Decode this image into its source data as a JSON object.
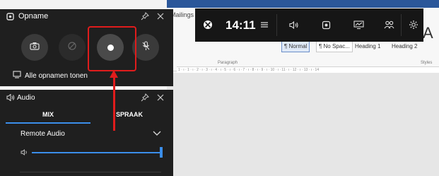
{
  "capture_panel": {
    "title": "Opname",
    "show_all_label": "Alle opnamen tonen"
  },
  "audio_panel": {
    "title": "Audio",
    "tabs": [
      "MIX",
      "SPRAAK"
    ],
    "active_tab": "MIX",
    "device": "Remote Audio",
    "volume_fraction": 1.0
  },
  "game_bar": {
    "time": "14:11"
  },
  "word_background": {
    "tab_label": "Mailings",
    "big_letter": "A",
    "styles": [
      "¶ Normal",
      "¶ No Spac...",
      "Heading 1",
      "Heading 2"
    ],
    "group_labels": [
      "Paragraph",
      "Styles"
    ],
    "ruler_text": "1 · ı · 1 · ı · 2 · ı · 3 · ı · 4 · ı · 5 · ı · 6 · ı · 7 · ı · 8 · ı · 9 · ı · 10 · ı · 11 · ı · 12 · ı · 13 · ı · 14"
  },
  "colors": {
    "panel_bg": "#1f1f1f",
    "accent": "#3b8eea",
    "annotation": "#e01c1c"
  }
}
